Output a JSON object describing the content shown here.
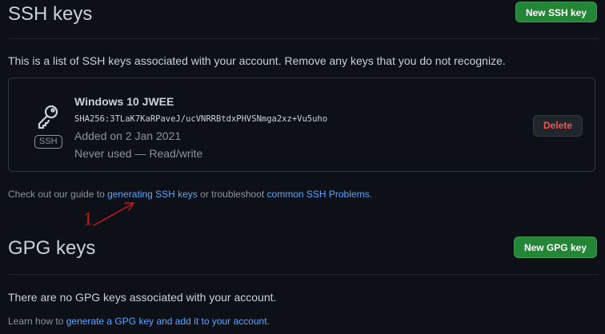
{
  "ssh": {
    "title": "SSH keys",
    "new_button": "New SSH key",
    "description": "This is a list of SSH keys associated with your account. Remove any keys that you do not recognize.",
    "key": {
      "badge": "SSH",
      "title": "Windows 10 JWEE",
      "fingerprint": "SHA256:3TLaK7KaRPaveJ/ucVNRRBtdxPHVSNmga2xz+Vu5uho",
      "added": "Added on 2 Jan 2021",
      "usage": "Never used — Read/write",
      "delete_label": "Delete"
    },
    "guide": {
      "prefix": "Check out our guide to ",
      "link1": "generating SSH keys",
      "middle": " or troubleshoot ",
      "link2": "common SSH Problems",
      "suffix": "."
    }
  },
  "gpg": {
    "title": "GPG keys",
    "new_button": "New GPG key",
    "empty": "There are no GPG keys associated with your account.",
    "learn": {
      "prefix": "Learn how to ",
      "link": "generate a GPG key and add it to your account",
      "suffix": "."
    }
  },
  "annotation": {
    "text": "1",
    "color": "#c9161b"
  },
  "colors": {
    "background": "#0d1117",
    "primary_button": "#238636",
    "danger_text": "#f85149",
    "link": "#58a6ff"
  }
}
